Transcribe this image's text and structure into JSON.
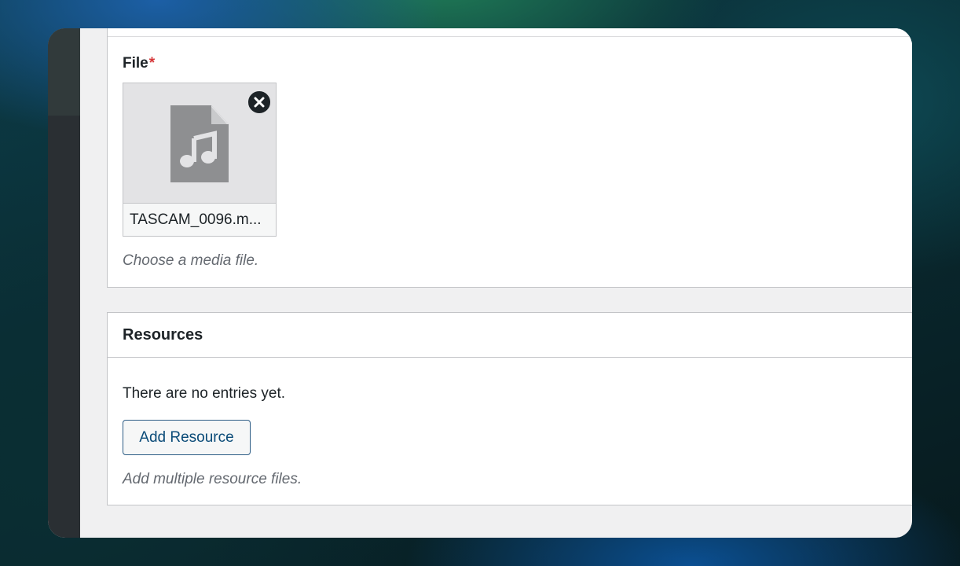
{
  "file_field": {
    "label": "File",
    "required_marker": "*",
    "media": {
      "filename": "TASCAM_0096.m...",
      "type_icon": "audio-file-icon",
      "remove_icon": "close-icon"
    },
    "description": "Choose a media file."
  },
  "resources": {
    "title": "Resources",
    "empty_message": "There are no entries yet.",
    "add_button_label": "Add Resource",
    "description": "Add multiple resource files."
  },
  "colors": {
    "required": "#d63638",
    "button_text": "#0a4b78",
    "button_border": "#2c5c85",
    "sidebar": "#2a2f33"
  }
}
